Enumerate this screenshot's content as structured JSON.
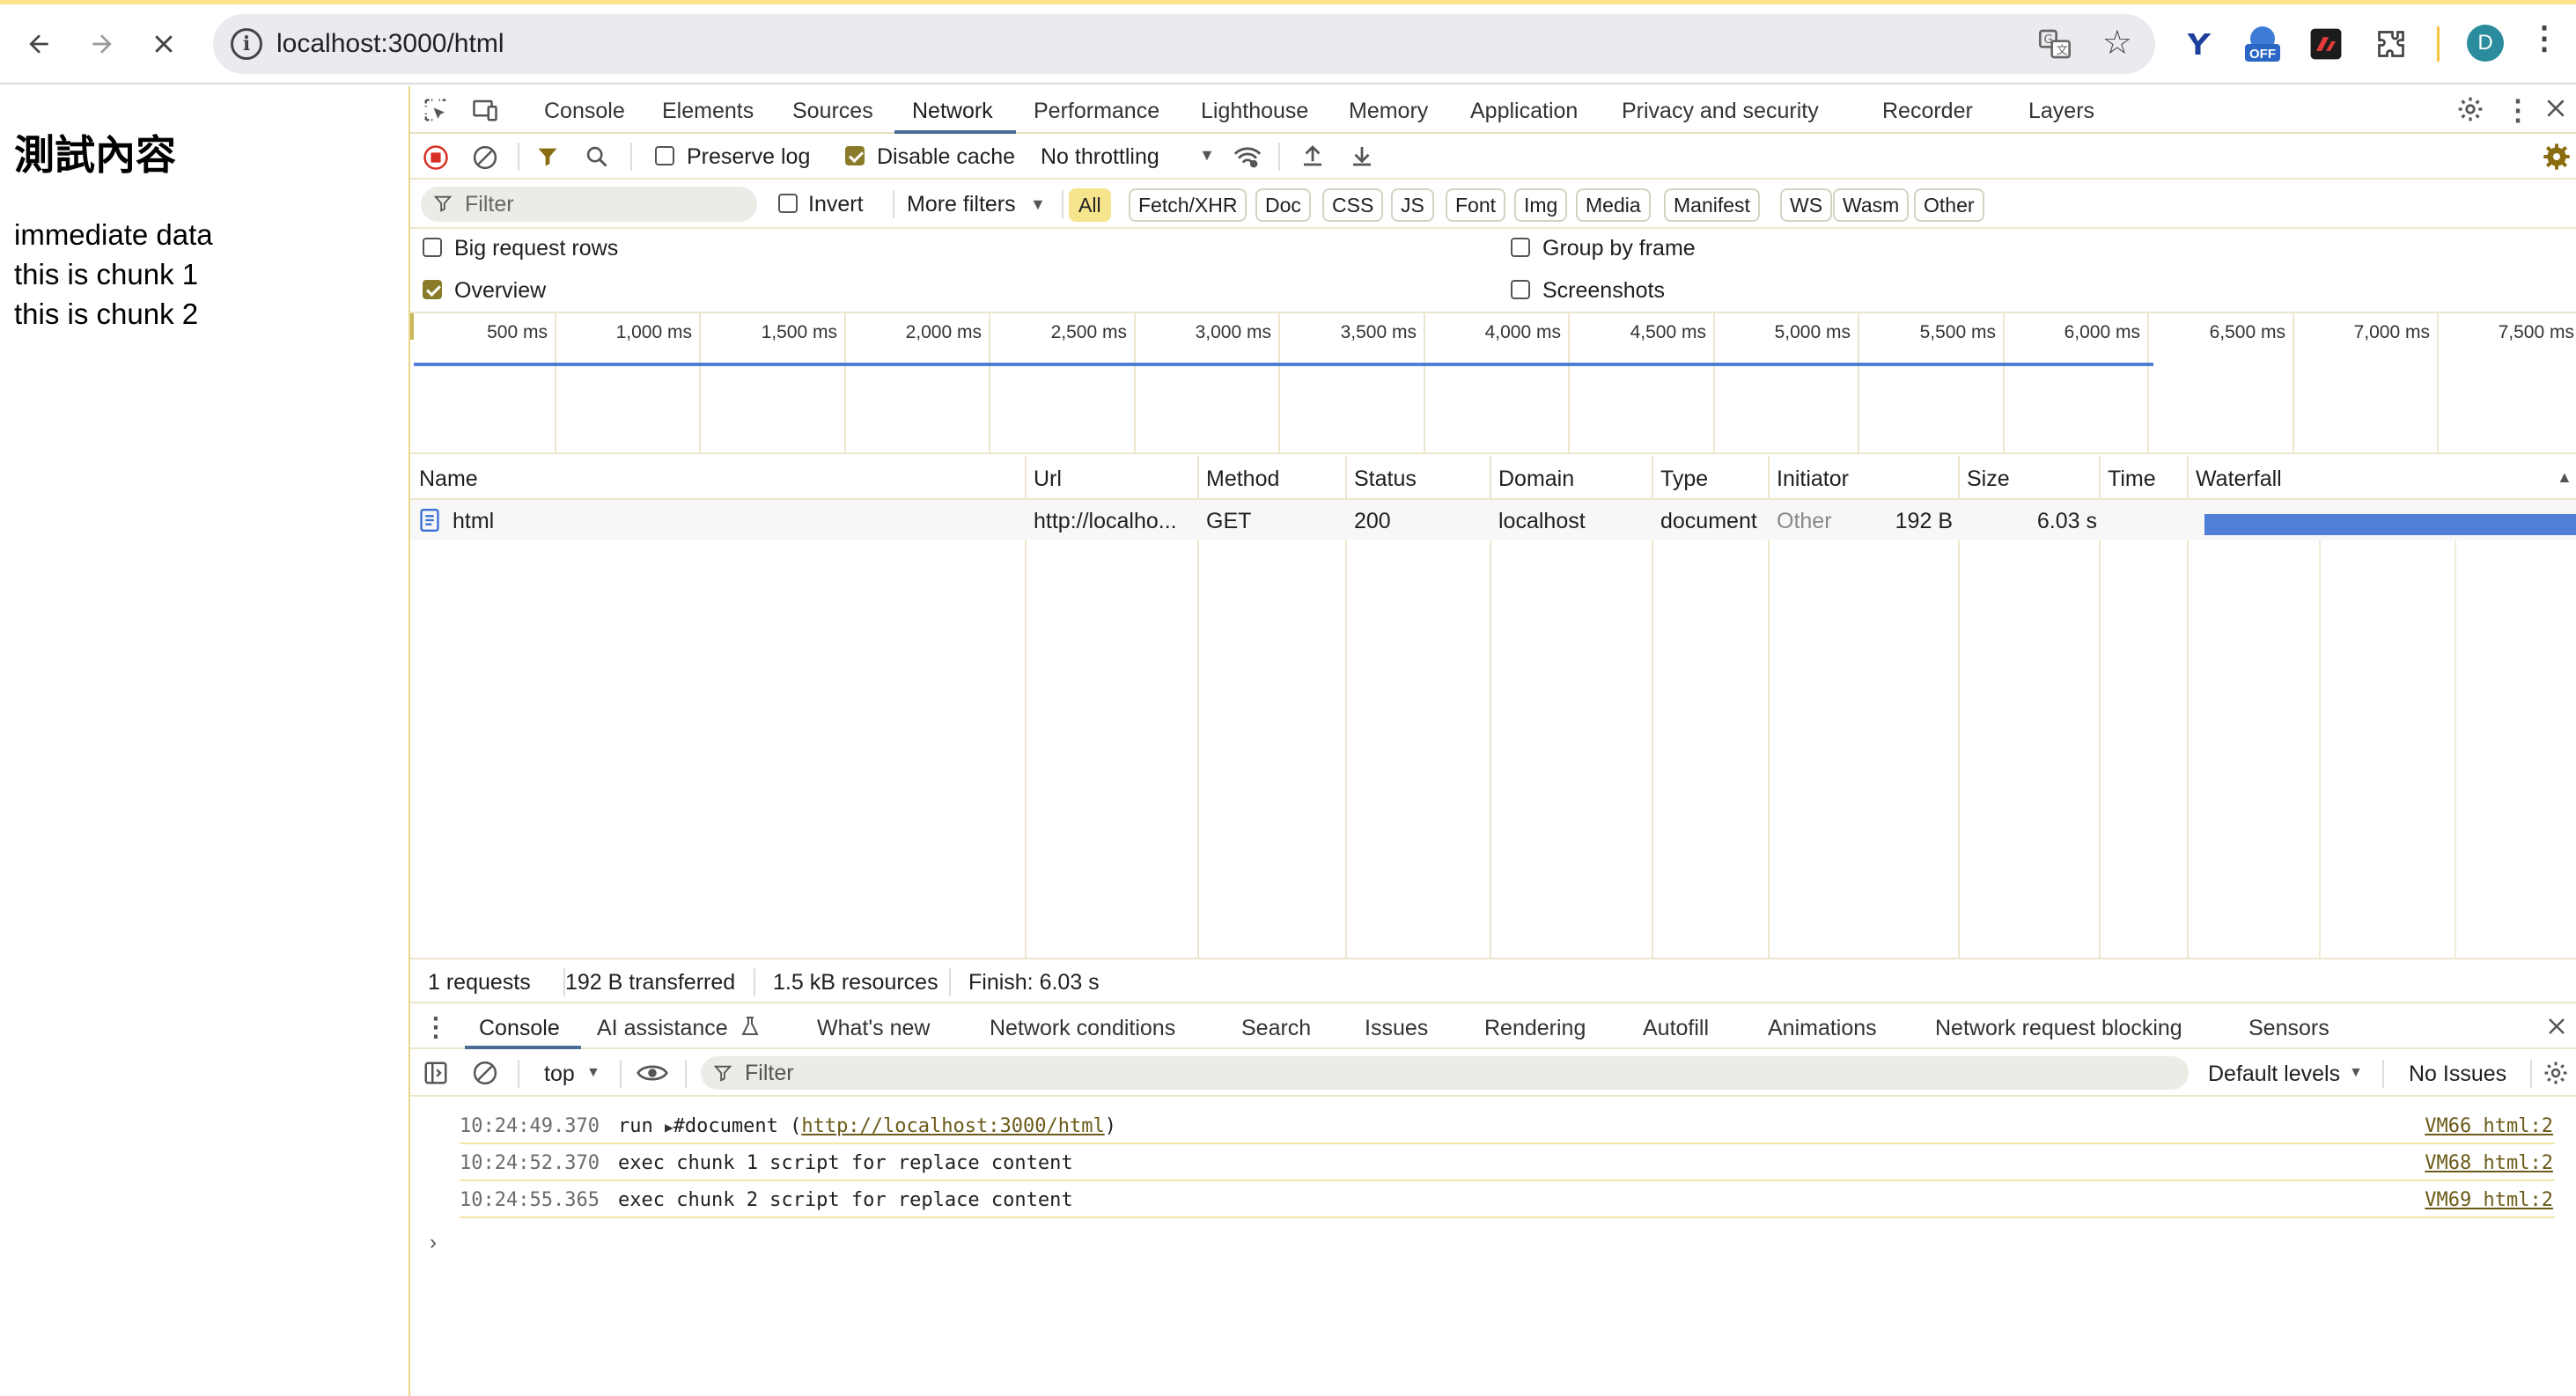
{
  "browser": {
    "url": "localhost:3000/html",
    "avatar_letter": "D",
    "ext_badge": "OFF"
  },
  "page": {
    "title": "測試內容",
    "lines": [
      "immediate data",
      "this is chunk 1",
      "this is chunk 2"
    ]
  },
  "devtools": {
    "tabs": [
      "Console",
      "Elements",
      "Sources",
      "Network",
      "Performance",
      "Lighthouse",
      "Memory",
      "Application",
      "Privacy and security",
      "Recorder",
      "Layers"
    ],
    "active_tab": "Network",
    "toolbar": {
      "preserve_log": "Preserve log",
      "preserve_log_checked": false,
      "disable_cache": "Disable cache",
      "disable_cache_checked": true,
      "throttling": "No throttling"
    },
    "filterbar": {
      "filter_placeholder": "Filter",
      "invert": "Invert",
      "more_filters": "More filters",
      "chips": [
        "All",
        "Fetch/XHR",
        "Doc",
        "CSS",
        "JS",
        "Font",
        "Img",
        "Media",
        "Manifest",
        "WS",
        "Wasm",
        "Other"
      ],
      "active_chip": "All"
    },
    "options": {
      "big_request_rows": "Big request rows",
      "overview": "Overview",
      "group_by_frame": "Group by frame",
      "screenshots": "Screenshots"
    },
    "overview_ticks": [
      "500 ms",
      "1,000 ms",
      "1,500 ms",
      "2,000 ms",
      "2,500 ms",
      "3,000 ms",
      "3,500 ms",
      "4,000 ms",
      "4,500 ms",
      "5,000 ms",
      "5,500 ms",
      "6,000 ms",
      "6,500 ms",
      "7,000 ms",
      "7,500 ms"
    ],
    "table": {
      "columns": [
        "Name",
        "Url",
        "Method",
        "Status",
        "Domain",
        "Type",
        "Initiator",
        "Size",
        "Time",
        "Waterfall"
      ],
      "rows": [
        {
          "name": "html",
          "url": "http://localho...",
          "method": "GET",
          "status": "200",
          "domain": "localhost",
          "type": "document",
          "initiator": "Other",
          "size": "192 B",
          "time": "6.03 s"
        }
      ]
    },
    "summary": {
      "requests": "1 requests",
      "transferred": "192 B transferred",
      "resources": "1.5 kB resources",
      "finish": "Finish: 6.03 s"
    },
    "drawer": {
      "tabs": [
        "Console",
        "AI assistance",
        "What's new",
        "Network conditions",
        "Search",
        "Issues",
        "Rendering",
        "Autofill",
        "Animations",
        "Network request blocking",
        "Sensors"
      ],
      "active_tab": "Console",
      "context": "top",
      "filter_placeholder": "Filter",
      "levels": "Default levels",
      "issues": "No Issues"
    },
    "console_messages": [
      {
        "time": "10:24:49.370",
        "text": "run ",
        "object": "#document (",
        "link": "http://localhost:3000/html",
        "suffix": ")",
        "source": "VM66 html:2"
      },
      {
        "time": "10:24:52.370",
        "text": "exec chunk 1 script for replace content",
        "source": "VM68 html:2"
      },
      {
        "time": "10:24:55.365",
        "text": "exec chunk 2 script for replace content",
        "source": "VM69 html:2"
      }
    ],
    "colors": {
      "accent": "#4a6b93",
      "waterfall": "#4f7fd6",
      "chip_active": "#f6e58d",
      "record": "#d93025"
    }
  }
}
